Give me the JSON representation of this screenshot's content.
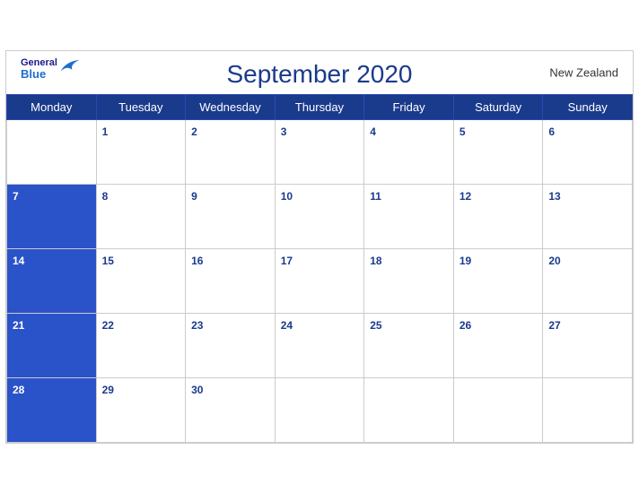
{
  "header": {
    "title": "September 2020",
    "country": "New Zealand",
    "logo": {
      "general": "General",
      "blue": "Blue"
    }
  },
  "weekdays": [
    "Monday",
    "Tuesday",
    "Wednesday",
    "Thursday",
    "Friday",
    "Saturday",
    "Sunday"
  ],
  "weeks": [
    [
      null,
      "1",
      "2",
      "3",
      "4",
      "5",
      "6"
    ],
    [
      "7",
      "8",
      "9",
      "10",
      "11",
      "12",
      "13"
    ],
    [
      "14",
      "15",
      "16",
      "17",
      "18",
      "19",
      "20"
    ],
    [
      "21",
      "22",
      "23",
      "24",
      "25",
      "26",
      "27"
    ],
    [
      "28",
      "29",
      "30",
      null,
      null,
      null,
      null
    ]
  ],
  "row_starts": [
    "7",
    "14",
    "21",
    "28"
  ]
}
